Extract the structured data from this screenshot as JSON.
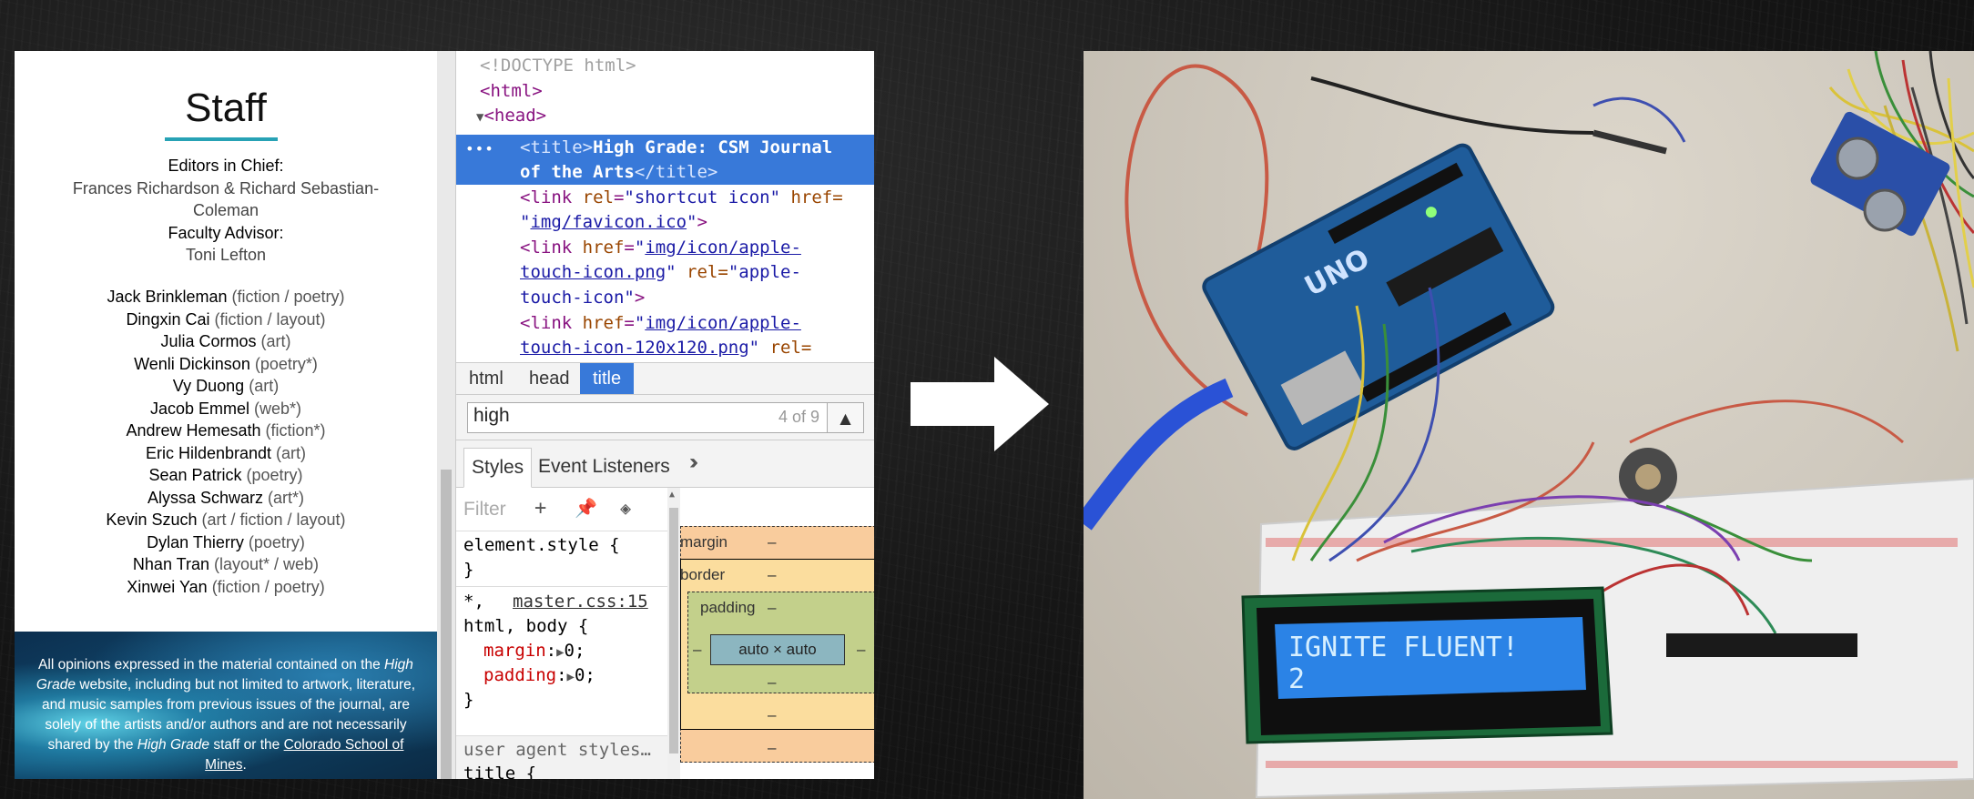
{
  "site": {
    "heading": "Staff",
    "roles": [
      {
        "label": "Editors in Chief:",
        "names": "Frances Richardson & Richard Sebastian-Coleman"
      },
      {
        "label": "Faculty Advisor:",
        "names": "Toni Lefton"
      }
    ],
    "members": [
      {
        "name": "Jack Brinkleman",
        "role": "(fiction / poetry)"
      },
      {
        "name": "Dingxin Cai",
        "role": "(fiction / layout)"
      },
      {
        "name": "Julia Cormos",
        "role": "(art)"
      },
      {
        "name": "Wenli Dickinson",
        "role": "(poetry*)"
      },
      {
        "name": "Vy Duong",
        "role": "(art)"
      },
      {
        "name": "Jacob Emmel",
        "role": "(web*)"
      },
      {
        "name": "Andrew Hemesath",
        "role": "(fiction*)"
      },
      {
        "name": "Eric Hildenbrandt",
        "role": "(art)"
      },
      {
        "name": "Sean Patrick",
        "role": "(poetry)"
      },
      {
        "name": "Alyssa Schwarz",
        "role": "(art*)"
      },
      {
        "name": "Kevin Szuch",
        "role": "(art / fiction / layout)"
      },
      {
        "name": "Dylan Thierry",
        "role": "(poetry)"
      },
      {
        "name": "Nhan Tran",
        "role": "(layout* / web)"
      },
      {
        "name": "Xinwei Yan",
        "role": "(fiction / poetry)"
      }
    ],
    "footer": {
      "p1": "All opinions expressed in the material contained on the",
      "em1": "High Grade",
      "p2": " website, including but not limited to artwork, literature, and music samples from previous issues of the journal, are solely of the artists and/or authors and are not necessarily shared by the ",
      "em2": "High Grade",
      "p3": " staff or the ",
      "link": "Colorado School of Mines",
      "p4": "."
    }
  },
  "devtools": {
    "dom": {
      "doctype": "<!DOCTYPE html>",
      "html_open": "<html>",
      "head_open": "<head>",
      "title_l1_tag": "<title>",
      "title_l1_text": "High Grade: CSM Journal",
      "title_l2_text": "of the Arts",
      "title_l2_close": "</title>",
      "link1_a": "<link ",
      "link1_attr1": "rel",
      "link1_val1": "\"shortcut icon\"",
      "link1_attr2": " href=",
      "link1_url": "img/favicon.ico",
      "link2_attr": "href",
      "link2_url_a": "img/icon/apple-",
      "link2_url_b": "touch-icon.png",
      "link2_attr2": " rel=",
      "link2_val_a": "\"apple-",
      "link2_val_b": "touch-icon\"",
      "link3_url_a": "img/icon/apple-",
      "link3_url_b": "touch-icon-120x120.png",
      "link3_tail": " rel="
    },
    "crumbs": [
      "html",
      "head",
      "title"
    ],
    "search": {
      "query": "high",
      "count": "4 of 9"
    },
    "tabs": [
      "Styles",
      "Event Listeners"
    ],
    "styles": {
      "filter_placeholder": "Filter",
      "element_style": "element.style {",
      "close": "}",
      "rule2_selector_a": "*,",
      "rule2_source": "master.css:15",
      "rule2_selector_b": "html, body {",
      "prop_margin": "margin",
      "prop_padding": "padding",
      "val_zero": "0;",
      "ua_label": "user agent styles…",
      "ua_selector": "title {"
    },
    "boxmodel": {
      "margin": "margin",
      "border": "border",
      "padding": "padding",
      "content": "auto × auto",
      "dash": "–"
    }
  },
  "photo": {
    "lcd_line1": "IGNITE FLUENT!",
    "lcd_line2": "2"
  }
}
